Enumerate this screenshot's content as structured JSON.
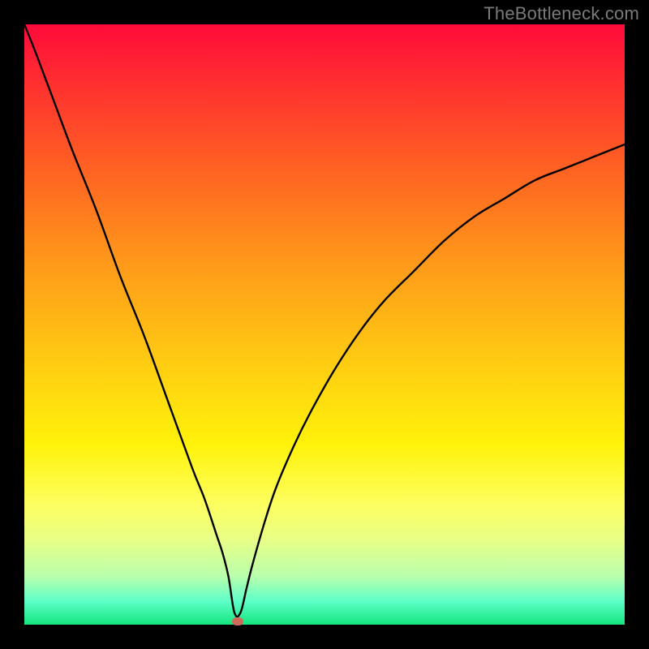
{
  "watermark": "TheBottleneck.com",
  "colors": {
    "frame_bg_top": "#ff0a3a",
    "frame_bg_bottom": "#14e67e",
    "curve": "#000000",
    "marker": "#d06a5a",
    "page_bg": "#000000"
  },
  "chart_data": {
    "type": "line",
    "title": "",
    "xlabel": "",
    "ylabel": "",
    "xlim": [
      0,
      100
    ],
    "ylim": [
      0,
      100
    ],
    "notch_x": 35,
    "marker": {
      "x": 35.5,
      "y": 0.5
    },
    "series": [
      {
        "name": "curve",
        "x": [
          0,
          2,
          5,
          8,
          12,
          16,
          20,
          24,
          28,
          30,
          32,
          33,
          34,
          35,
          36,
          37,
          38,
          40,
          42,
          45,
          48,
          52,
          56,
          60,
          65,
          70,
          75,
          80,
          85,
          90,
          95,
          100
        ],
        "y": [
          100,
          95,
          87,
          79,
          69,
          58,
          48,
          37,
          26,
          21,
          15,
          12,
          8,
          2,
          2,
          6,
          10,
          17,
          23,
          30,
          36,
          43,
          49,
          54,
          59,
          64,
          68,
          71,
          74,
          76,
          78,
          80
        ]
      }
    ]
  }
}
